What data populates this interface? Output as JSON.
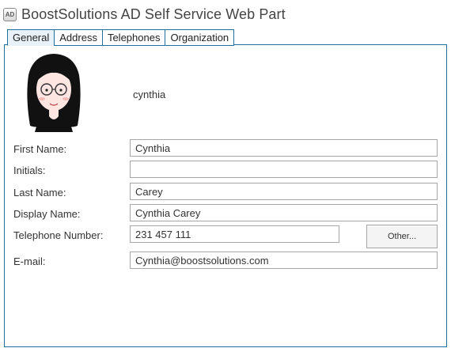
{
  "app": {
    "title": "BoostSolutions AD Self Service Web Part",
    "icon_text": "AD"
  },
  "tabs": [
    {
      "label": "General",
      "active": true
    },
    {
      "label": "Address",
      "active": false
    },
    {
      "label": "Telephones",
      "active": false
    },
    {
      "label": "Organization",
      "active": false
    }
  ],
  "profile": {
    "username": "cynthia"
  },
  "form": {
    "first_name": {
      "label": "First Name:",
      "value": "Cynthia"
    },
    "initials": {
      "label": "Initials:",
      "value": ""
    },
    "last_name": {
      "label": "Last Name:",
      "value": "Carey"
    },
    "display_name": {
      "label": "Display Name:",
      "value": "Cynthia Carey"
    },
    "telephone": {
      "label": "Telephone Number:",
      "value": "231 457 111"
    },
    "email": {
      "label": "E-mail:",
      "value": "Cynthia@boostsolutions.com"
    },
    "other_button_label": "Other..."
  },
  "colors": {
    "accent_border": "#1f6f9f",
    "field_border": "#a6a6a6"
  }
}
